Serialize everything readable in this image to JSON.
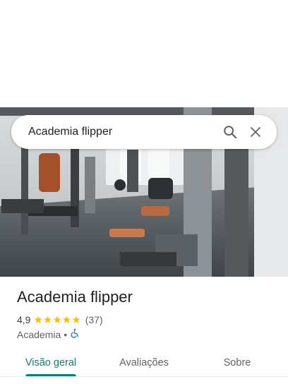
{
  "search": {
    "query": "Academia flipper"
  },
  "place": {
    "name": "Academia flipper",
    "rating": "4,9",
    "stars": "★★★★★",
    "review_count": "(37)",
    "category": "Academia",
    "separator": "•"
  },
  "tabs": [
    {
      "label": "Visão geral",
      "active": true
    },
    {
      "label": "Avaliações",
      "active": false
    },
    {
      "label": "Sobre",
      "active": false
    }
  ],
  "colors": {
    "accent": "#0b7f7a",
    "star": "#fbbc04",
    "access": "#1a73e8"
  }
}
